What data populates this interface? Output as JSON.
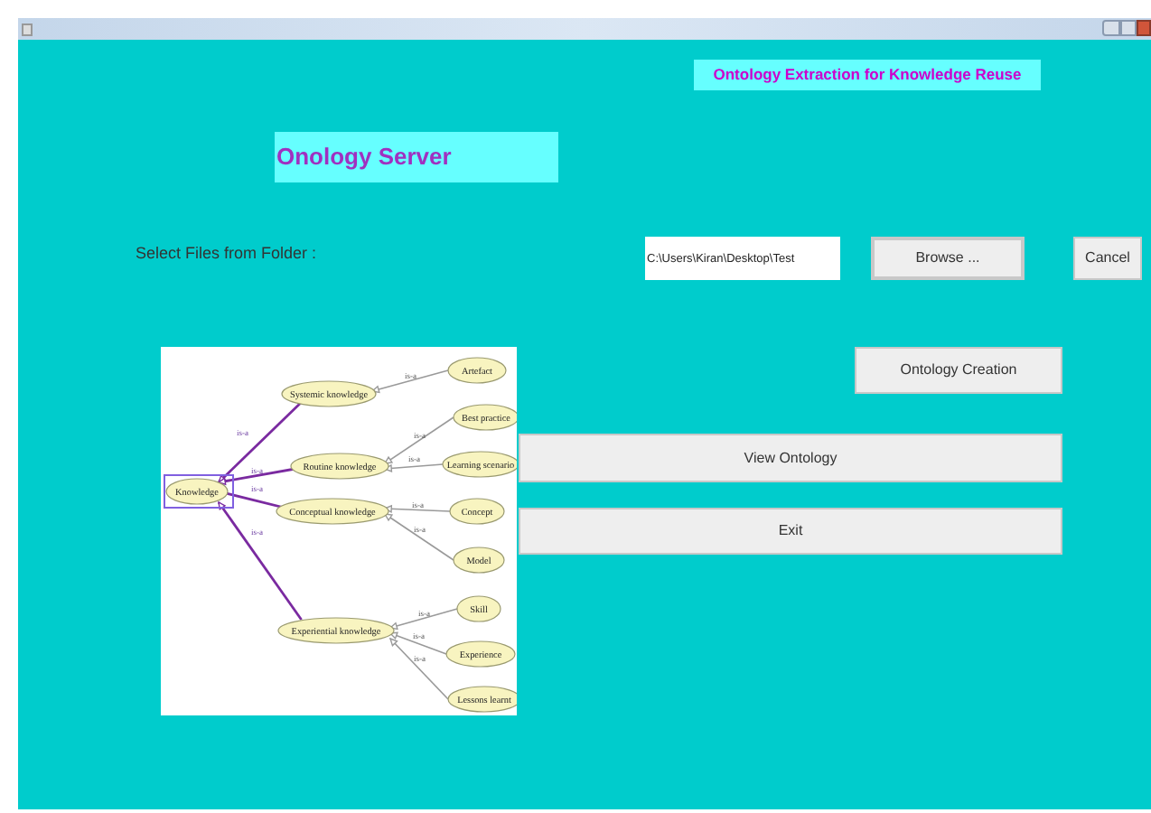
{
  "header_title": "Ontology Extraction for Knowledge Reuse",
  "server_title": "Onology Server",
  "folder_label": "Select Files from Folder :",
  "path_field": {
    "value": "C:\\Users\\Kiran\\Desktop\\Test"
  },
  "buttons": {
    "browse": "Browse ...",
    "cancel": "Cancel",
    "ontology_creation": "Ontology Creation",
    "view_ontology": "View Ontology",
    "exit": "Exit"
  },
  "diagram": {
    "root": {
      "label": "Knowledge",
      "selected": true,
      "children": [
        {
          "label": "Systemic knowledge",
          "edge_label": "is-a",
          "children": [
            {
              "label": "Artefact",
              "edge_label": "is-a"
            }
          ]
        },
        {
          "label": "Routine knowledge",
          "edge_label": "is-a",
          "children": [
            {
              "label": "Best practice",
              "edge_label": "is-a"
            },
            {
              "label": "Learning scenario",
              "edge_label": "is-a"
            }
          ]
        },
        {
          "label": "Conceptual knowledge",
          "edge_label": "is-a",
          "children": [
            {
              "label": "Concept",
              "edge_label": "is-a"
            },
            {
              "label": "Model",
              "edge_label": "is-a"
            }
          ]
        },
        {
          "label": "Experiential knowledge",
          "edge_label": "is-a",
          "children": [
            {
              "label": "Skill",
              "edge_label": "is-a"
            },
            {
              "label": "Experience",
              "edge_label": "is-a"
            },
            {
              "label": "Lessons learnt",
              "edge_label": "is-a"
            }
          ]
        }
      ]
    }
  }
}
